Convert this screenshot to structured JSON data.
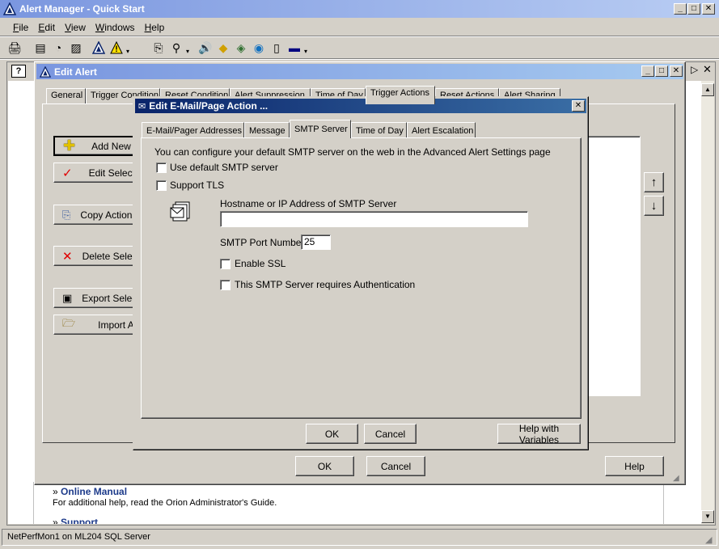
{
  "main_window": {
    "title": "Alert Manager - Quick Start",
    "menu": [
      "File",
      "Edit",
      "View",
      "Windows",
      "Help"
    ],
    "status_text": "NetPerfMon1 on ML204 SQL Server"
  },
  "quickstart": {
    "online_manual_title": "Online Manual",
    "online_manual_desc": "For additional help, read the Orion Administrator's Guide.",
    "support_title": "Support",
    "bullet": "»"
  },
  "edit_alert": {
    "title": "Edit Alert",
    "tabs": [
      "General",
      "Trigger Condition",
      "Reset Condition",
      "Alert Suppression",
      "Time of Day",
      "Trigger Actions",
      "Reset Actions",
      "Alert Sharing"
    ],
    "side_buttons": [
      "Add New",
      "Edit Select",
      "Copy Actions",
      "Delete Selec",
      "Export Selec",
      "Import A"
    ],
    "ok_label": "OK",
    "cancel_label": "Cancel",
    "help_label": "Help"
  },
  "edit_action": {
    "title": "Edit E-Mail/Page Action ...",
    "tabs": [
      "E-Mail/Pager Addresses",
      "Message",
      "SMTP Server",
      "Time of Day",
      "Alert Escalation"
    ],
    "info_text": "You can configure your default SMTP server on the web in the Advanced Alert Settings page",
    "use_default_label": "Use default SMTP server",
    "support_tls_label": "Support TLS",
    "hostname_label": "Hostname or IP Address of SMTP Server",
    "hostname_value": "",
    "port_label": "SMTP Port Number",
    "port_value": "25",
    "enable_ssl_label": "Enable SSL",
    "auth_label": "This SMTP Server requires Authentication",
    "ok_label": "OK",
    "cancel_label": "Cancel",
    "help_vars_label": "Help with Variables"
  },
  "icons": {
    "app": "orion-triangle-icon",
    "up_arrow": "↑",
    "down_arrow": "↓"
  },
  "colors": {
    "link": "#1c3a8a",
    "active_title": "#0a246a",
    "inactive_title": "#7a96df"
  }
}
